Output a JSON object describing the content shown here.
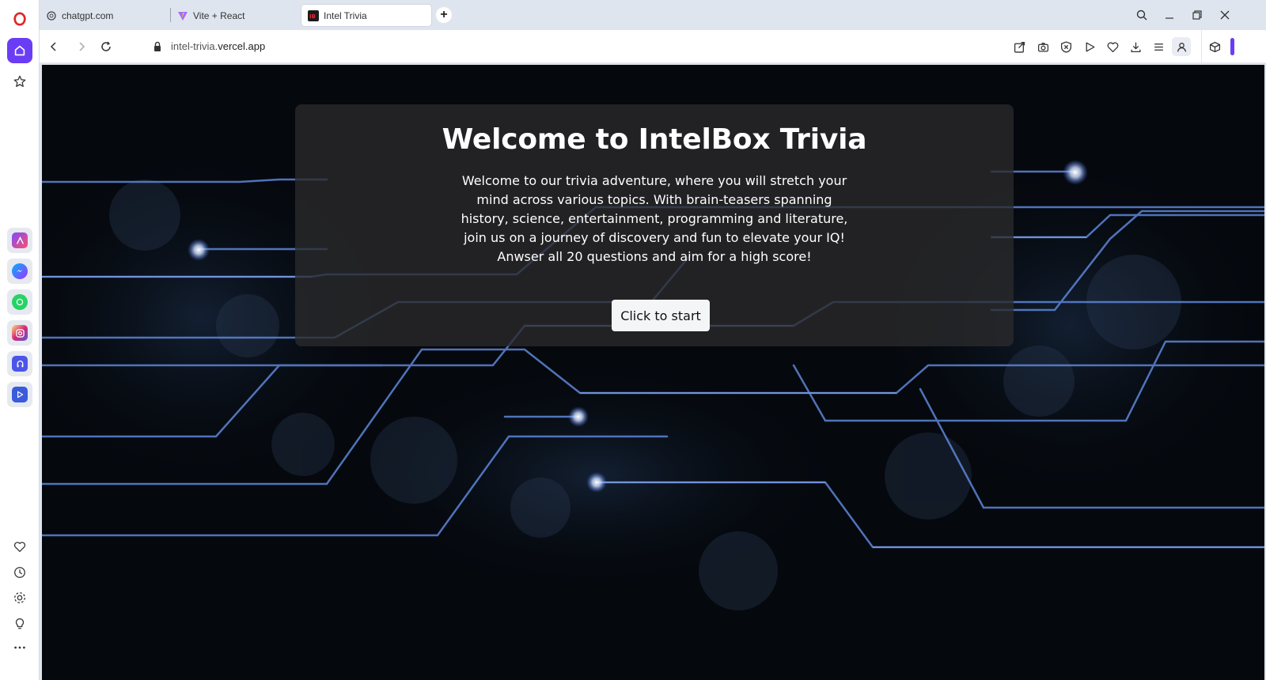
{
  "browser": {
    "tabs": [
      {
        "label": "chatgpt.com",
        "icon": "chatgpt-icon"
      },
      {
        "label": "Vite + React",
        "icon": "vite-icon"
      },
      {
        "label": "Intel Trivia",
        "icon": "intelbox-icon",
        "active": true
      }
    ],
    "url": {
      "subdomain": "intel-trivia.",
      "domain": "vercel.app"
    },
    "accent_color": "#6a3df5"
  },
  "sidebar": {
    "top": [
      "opera-logo-icon",
      "home-icon",
      "star-icon"
    ],
    "apps": [
      "aria-icon",
      "messenger-icon",
      "whatsapp-icon",
      "instagram-icon",
      "music-player-icon",
      "video-popout-icon"
    ],
    "bottom": [
      "heart-icon",
      "history-icon",
      "settings-icon",
      "lightbulb-icon",
      "more-icon"
    ]
  },
  "main": {
    "title": "Welcome to IntelBox Trivia",
    "description": "Welcome to our trivia adventure, where you will stretch your mind across various topics. With brain-teasers spanning history, science, entertainment, programming and literature, join us on a journey of discovery and fun to elevate your IQ! Anwser all 20 questions and aim for a high score!",
    "start_button": "Click to start"
  }
}
